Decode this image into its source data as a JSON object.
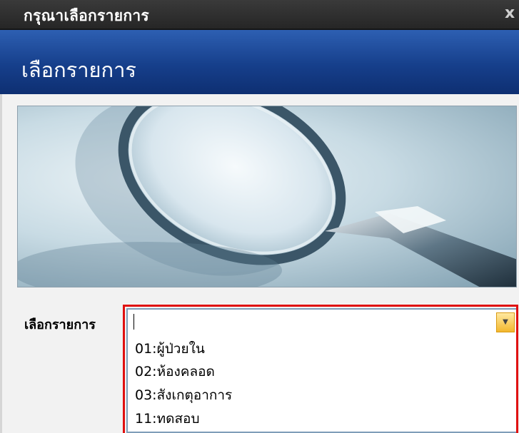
{
  "window": {
    "title": "กรุณาเลือกรายการ",
    "close_glyph": "x"
  },
  "banner": {
    "heading": "เลือกรายการ"
  },
  "hero": {
    "subject": "magnifying-glass"
  },
  "form": {
    "field_label": "เลือกรายการ",
    "combo_value": "",
    "dropdown_options": [
      "01:ผู้ป่วยใน",
      "02:ห้องคลอด",
      "03:สังเกตุอาการ",
      "11:ทดสอบ"
    ]
  },
  "colors": {
    "banner": "#163f8b",
    "titlebar": "#2e2e2e",
    "highlight": "#e01010",
    "dropdown_button": "#f2b72e"
  }
}
